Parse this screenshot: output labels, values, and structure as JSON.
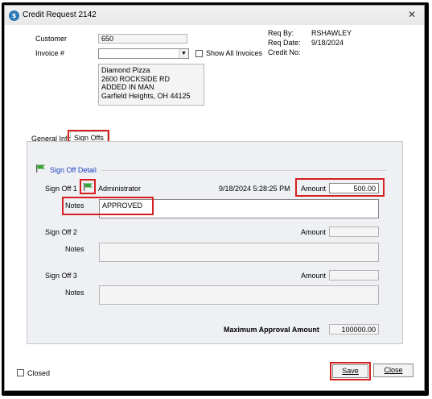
{
  "window": {
    "title": "Credit Request 2142",
    "close_glyph": "✕"
  },
  "header": {
    "customer_label": "Customer",
    "customer_value": "650",
    "invoice_label": "Invoice #",
    "invoice_value": "",
    "show_all_invoices_label": "Show All Invoices",
    "address_lines": [
      "Diamond Pizza",
      "2600 ROCKSIDE RD",
      "ADDED IN MAN",
      "Garfield Heights, OH  44125"
    ],
    "req_by_label": "Req By:",
    "req_by_value": "RSHAWLEY",
    "req_date_label": "Req Date:",
    "req_date_value": "9/18/2024",
    "credit_no_label": "Credit No:",
    "credit_no_value": ""
  },
  "tabs": {
    "general_info": "General Info",
    "sign_offs": "Sign Offs",
    "active": "sign_offs"
  },
  "signoffs": {
    "section_title": "Sign Off Detail",
    "amount_label": "Amount",
    "notes_label": "Notes",
    "items": [
      {
        "label": "Sign Off 1",
        "user": "Administrator",
        "timestamp": "9/18/2024 5:28:25 PM",
        "amount": "500.00",
        "notes": "APPROVED"
      },
      {
        "label": "Sign Off 2",
        "user": "",
        "timestamp": "",
        "amount": "",
        "notes": ""
      },
      {
        "label": "Sign Off 3",
        "user": "",
        "timestamp": "",
        "amount": "",
        "notes": ""
      }
    ],
    "max_label": "Maximum Approval Amount",
    "max_value": "100000.00"
  },
  "footer": {
    "closed_label": "Closed",
    "save_label": "Save",
    "close_label": "Close"
  },
  "icons": {
    "flag": "green-flag-icon"
  },
  "colors": {
    "highlight": "#d62020",
    "section_title": "#1f3fbf"
  }
}
